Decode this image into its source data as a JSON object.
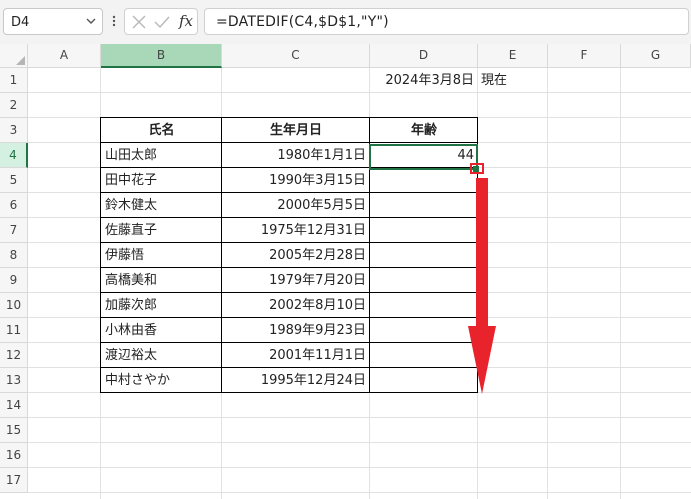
{
  "formula_bar": {
    "name_box": "D4",
    "fx_label": "fx",
    "formula": "=DATEDIF(C4,$D$1,\"Y\")"
  },
  "columns": [
    "A",
    "B",
    "C",
    "D",
    "E",
    "F",
    "G"
  ],
  "rows": [
    "1",
    "2",
    "3",
    "4",
    "5",
    "6",
    "7",
    "8",
    "9",
    "10",
    "11",
    "12",
    "13",
    "14",
    "15",
    "16",
    "17"
  ],
  "selected_cell": "D4",
  "cells": {
    "d1": "2024年3月8日",
    "e1": "現在",
    "headers": {
      "name": "氏名",
      "birthdate": "生年月日",
      "age": "年齢"
    },
    "d4": "44"
  },
  "records": [
    {
      "name": "山田太郎",
      "birthdate": "1980年1月1日"
    },
    {
      "name": "田中花子",
      "birthdate": "1990年3月15日"
    },
    {
      "name": "鈴木健太",
      "birthdate": "2000年5月5日"
    },
    {
      "name": "佐藤直子",
      "birthdate": "1975年12月31日"
    },
    {
      "name": "伊藤悟",
      "birthdate": "2005年2月28日"
    },
    {
      "name": "高橋美和",
      "birthdate": "1979年7月20日"
    },
    {
      "name": "加藤次郎",
      "birthdate": "2002年8月10日"
    },
    {
      "name": "小林由香",
      "birthdate": "1989年9月23日"
    },
    {
      "name": "渡辺裕太",
      "birthdate": "2001年11月1日"
    },
    {
      "name": "中村さやか",
      "birthdate": "1995年12月24日"
    }
  ],
  "colors": {
    "accent": "#217346",
    "annotation": "#e8232b"
  }
}
